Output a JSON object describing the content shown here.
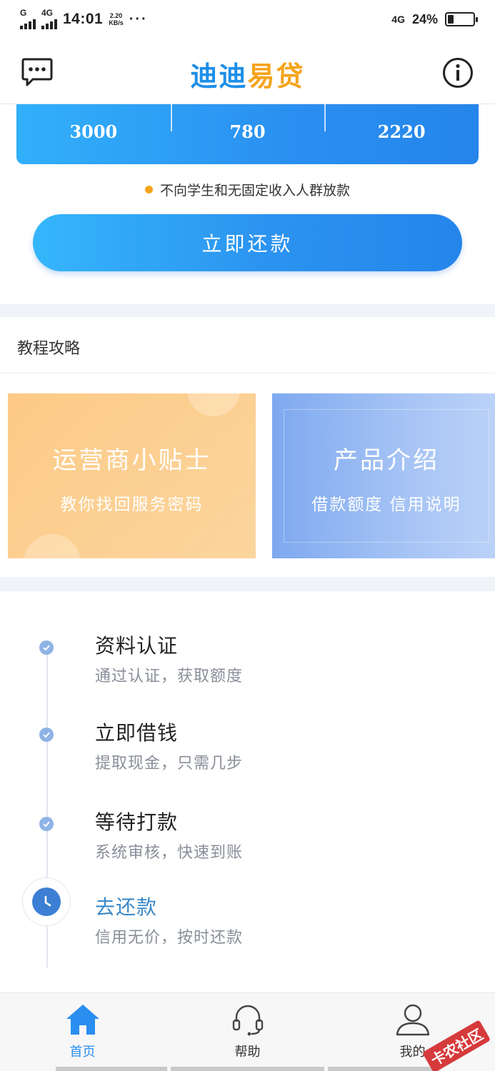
{
  "status_bar": {
    "net1": "G",
    "net2": "4G",
    "time": "14:01",
    "speed_value": "2.20",
    "speed_unit": "KB/s",
    "more": "···",
    "net_right": "4G",
    "battery": "24%",
    "battery_level": 0.24
  },
  "header": {
    "logo_part1": "迪迪",
    "logo_part2": "易贷",
    "logo_color_primary": "#1e8fe8",
    "logo_color_secondary": "#f5a31a"
  },
  "loan_card": {
    "values": [
      "3000",
      "780",
      "2220"
    ]
  },
  "notice": "不向学生和无固定收入人群放款",
  "repay_button": "立即还款",
  "tutorial": {
    "title": "教程攻略",
    "cards": [
      {
        "title": "运营商小贴士",
        "subtitle": "教你找回服务密码"
      },
      {
        "title": "产品介绍",
        "subtitle": "借款额度 信用说明"
      }
    ]
  },
  "steps": [
    {
      "title": "资料认证",
      "desc": "通过认证，获取额度"
    },
    {
      "title": "立即借钱",
      "desc": "提取现金，只需几步"
    },
    {
      "title": "等待打款",
      "desc": "系统审核，快速到账"
    },
    {
      "title": "去还款",
      "desc": "信用无价，按时还款"
    }
  ],
  "tabbar": {
    "home": "首页",
    "help": "帮助",
    "mine": "我的",
    "active_color": "#2a8ef0"
  },
  "watermark": "卡农社区"
}
